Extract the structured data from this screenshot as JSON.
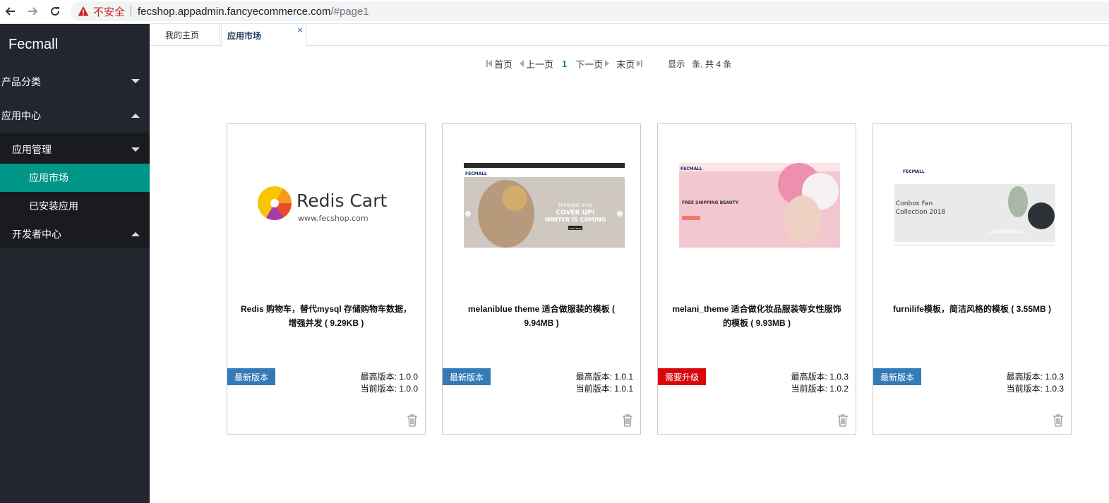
{
  "browser": {
    "insecure_label": "不安全",
    "url_host": "fecshop.appadmin.fancyecommerce.com",
    "url_path": "/#page1"
  },
  "sidebar": {
    "brand": "Fecmall",
    "items": [
      {
        "label": "产品分类"
      },
      {
        "label": "应用中心"
      }
    ],
    "sub": [
      {
        "label": "应用管理"
      },
      {
        "label": "应用市场"
      },
      {
        "label": "已安装应用"
      },
      {
        "label": "开发者中心"
      }
    ]
  },
  "tabs": [
    {
      "label": "我的主页"
    },
    {
      "label": "应用市场",
      "close": "×"
    }
  ],
  "pager": {
    "first": "首页",
    "prev": "上一页",
    "current": "1",
    "next": "下一页",
    "last": "末页",
    "show": "显示",
    "total": "条, 共 4 条"
  },
  "cards": [
    {
      "title": "Redis 购物车，替代mysql 存储购物车数据，增强并发 ( 9.29KB )",
      "badge": "最新版本",
      "max_version": "最高版本: 1.0.0",
      "cur_version": "当前版本: 1.0.0",
      "thumb_main": "Redis Cart",
      "thumb_sub": "www.fecshop.com"
    },
    {
      "title": "melaniblue theme 适合做服装的模板 ( 9.94MB )",
      "badge": "最新版本",
      "max_version": "最高版本: 1.0.1",
      "cur_version": "当前版本: 1.0.1",
      "thumb_logo": "FECMALL",
      "thumb_kicker": "TRENDING 2018",
      "thumb_line1": "COVER UP!",
      "thumb_line2": "WINTER IS COMING",
      "thumb_btn": "SHOP NOW"
    },
    {
      "title": "melani_theme 适合做化妆品服装等女性服饰的模板 ( 9.93MB )",
      "badge": "需要升级",
      "max_version": "最高版本: 1.0.3",
      "cur_version": "当前版本: 1.0.2",
      "thumb_logo": "FECMALL",
      "thumb_line1": "FREE SHIPPING BEAUTY"
    },
    {
      "title": "furnilife模板，简洁风格的模板 ( 3.55MB )",
      "badge": "最新版本",
      "max_version": "最高版本: 1.0.3",
      "cur_version": "当前版本: 1.0.3",
      "thumb_logo": "FECMALL",
      "thumb_line1": "Conbox Fan",
      "thumb_line2": "Collection 2018"
    }
  ],
  "colors": {
    "sidebar_bg": "#23262e",
    "active": "#009688",
    "badge_latest": "#337ab7",
    "badge_upgrade": "#d9070c"
  }
}
